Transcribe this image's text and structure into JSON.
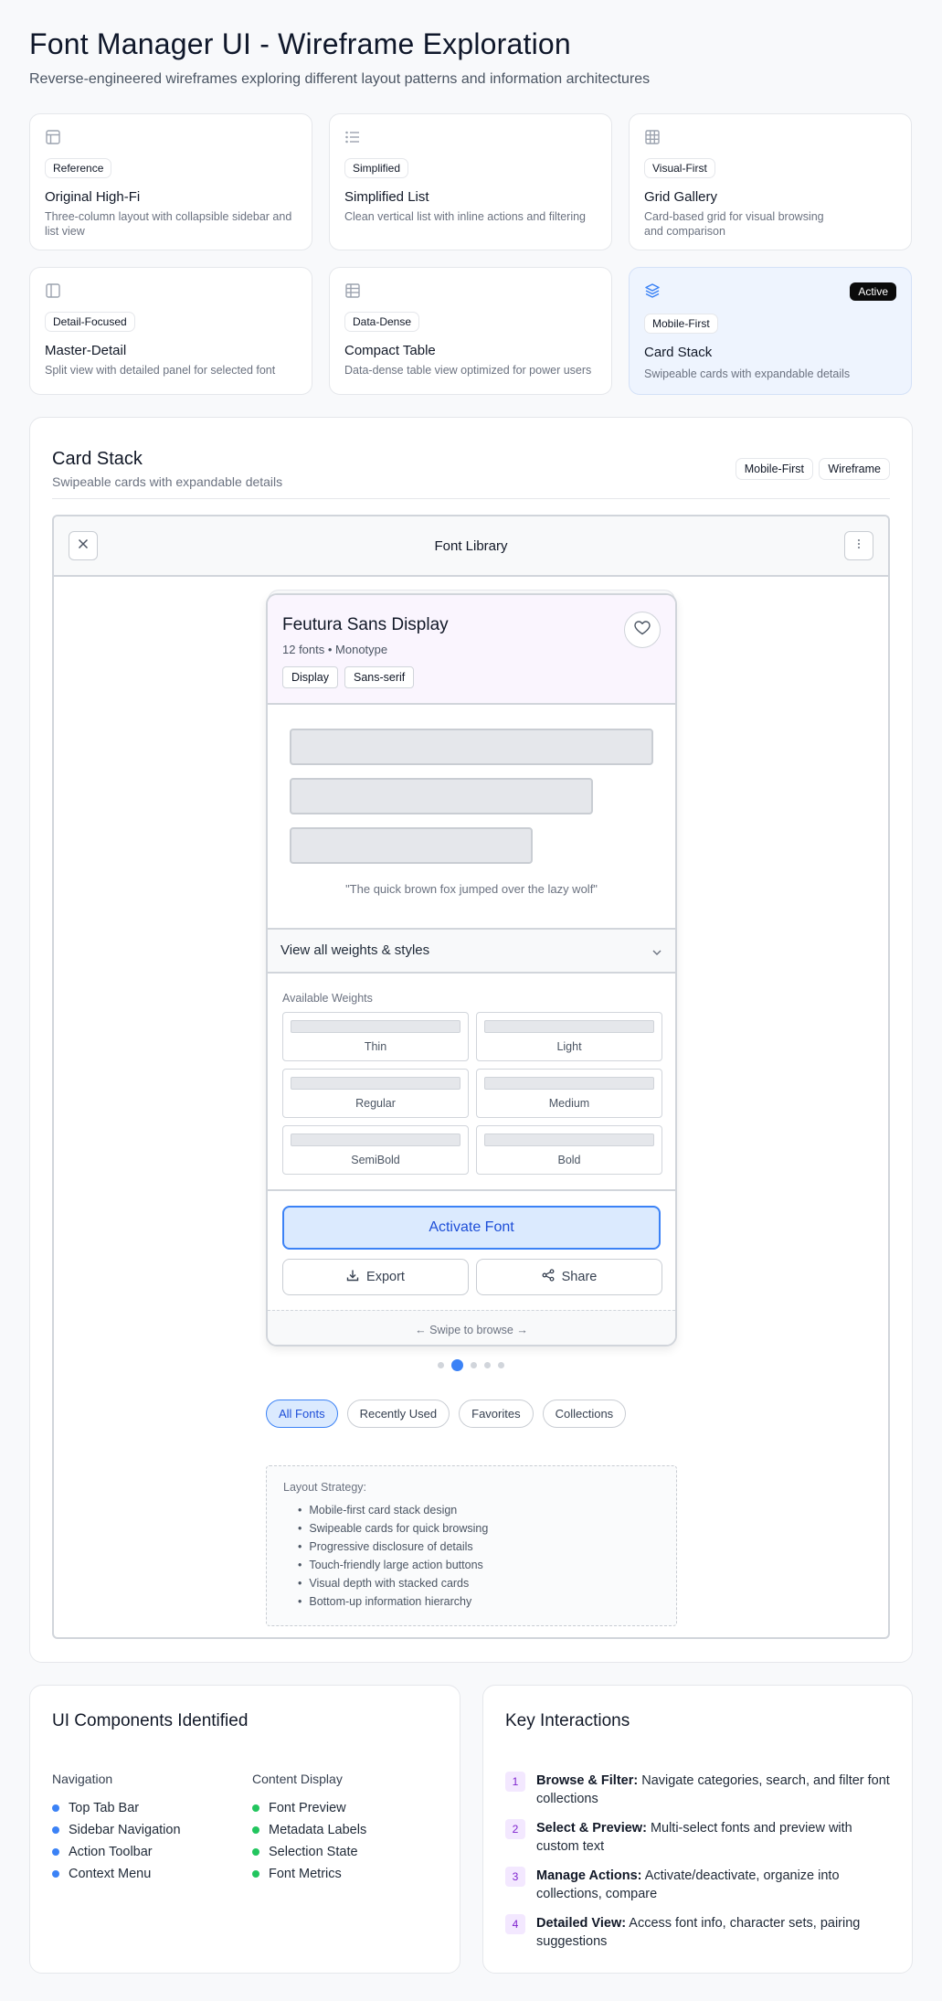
{
  "header": {
    "title": "Font Manager UI - Wireframe Exploration",
    "subtitle": "Reverse-engineered wireframes exploring different layout patterns and information architectures"
  },
  "variants": [
    {
      "icon": "layout-icon",
      "tag": "Reference",
      "title": "Original High-Fi",
      "desc": "Three-column layout with collapsible sidebar and list view"
    },
    {
      "icon": "list-icon",
      "tag": "Simplified",
      "title": "Simplified List",
      "desc": "Clean vertical list with inline actions and filtering"
    },
    {
      "icon": "grid-icon",
      "tag": "Visual-First",
      "title": "Grid Gallery",
      "desc": "Card-based grid for visual browsing and comparison"
    },
    {
      "icon": "panel-left-icon",
      "tag": "Detail-Focused",
      "title": "Master-Detail",
      "desc": "Split view with detailed panel for selected font"
    },
    {
      "icon": "table-icon",
      "tag": "Data-Dense",
      "title": "Compact Table",
      "desc": "Data-dense table view optimized for power users"
    },
    {
      "icon": "layers-icon",
      "tag": "Mobile-First",
      "title": "Card Stack",
      "desc": "Swipeable cards with expandable details",
      "badge": "Active"
    }
  ],
  "panel": {
    "title": "Card Stack",
    "subtitle": "Swipeable cards with expandable details",
    "chips": [
      "Mobile-First",
      "Wireframe"
    ]
  },
  "frame": {
    "title": "Font Library",
    "close_icon": "close-icon",
    "more_icon": "more-vertical-icon"
  },
  "font_card": {
    "name": "Feutura Sans Display",
    "meta": "12 fonts • Monotype",
    "tags": [
      "Display",
      "Sans-serif"
    ],
    "quote": "\"The quick brown fox jumped over the lazy wolf\"",
    "expander": "View all weights & styles",
    "weights_label": "Available Weights",
    "weights": [
      "Thin",
      "Light",
      "Regular",
      "Medium",
      "SemiBold",
      "Bold"
    ],
    "activate": "Activate Font",
    "export": "Export",
    "share": "Share",
    "swipe": "← Swipe to browse →"
  },
  "pagination": {
    "count": 5,
    "active_index": 1
  },
  "filters": [
    "All Fonts",
    "Recently Used",
    "Favorites",
    "Collections"
  ],
  "strategy": {
    "title": "Layout Strategy:",
    "items": [
      "Mobile-first card stack design",
      "Swipeable cards for quick browsing",
      "Progressive disclosure of details",
      "Touch-friendly large action buttons",
      "Visual depth with stacked cards",
      "Bottom-up information hierarchy"
    ]
  },
  "components": {
    "title": "UI Components Identified",
    "navigation_title": "Navigation",
    "navigation": [
      "Top Tab Bar",
      "Sidebar Navigation",
      "Action Toolbar",
      "Context Menu"
    ],
    "content_title": "Content Display",
    "content": [
      "Font Preview",
      "Metadata Labels",
      "Selection State",
      "Font Metrics"
    ]
  },
  "interactions": {
    "title": "Key Interactions",
    "items": [
      {
        "num": "1",
        "label": "Browse & Filter:",
        "text": "Navigate categories, search, and filter font collections"
      },
      {
        "num": "2",
        "label": "Select & Preview:",
        "text": "Multi-select fonts and preview with custom text"
      },
      {
        "num": "3",
        "label": "Manage Actions:",
        "text": "Activate/deactivate, organize into collections, compare"
      },
      {
        "num": "4",
        "label": "Detailed View:",
        "text": "Access font info, character sets, pairing suggestions"
      }
    ]
  },
  "colors": {
    "accent": "#3b82f6",
    "nav_bullet": "#3b82f6",
    "content_bullet": "#22c55e",
    "number_bg": "#f3e8ff"
  }
}
